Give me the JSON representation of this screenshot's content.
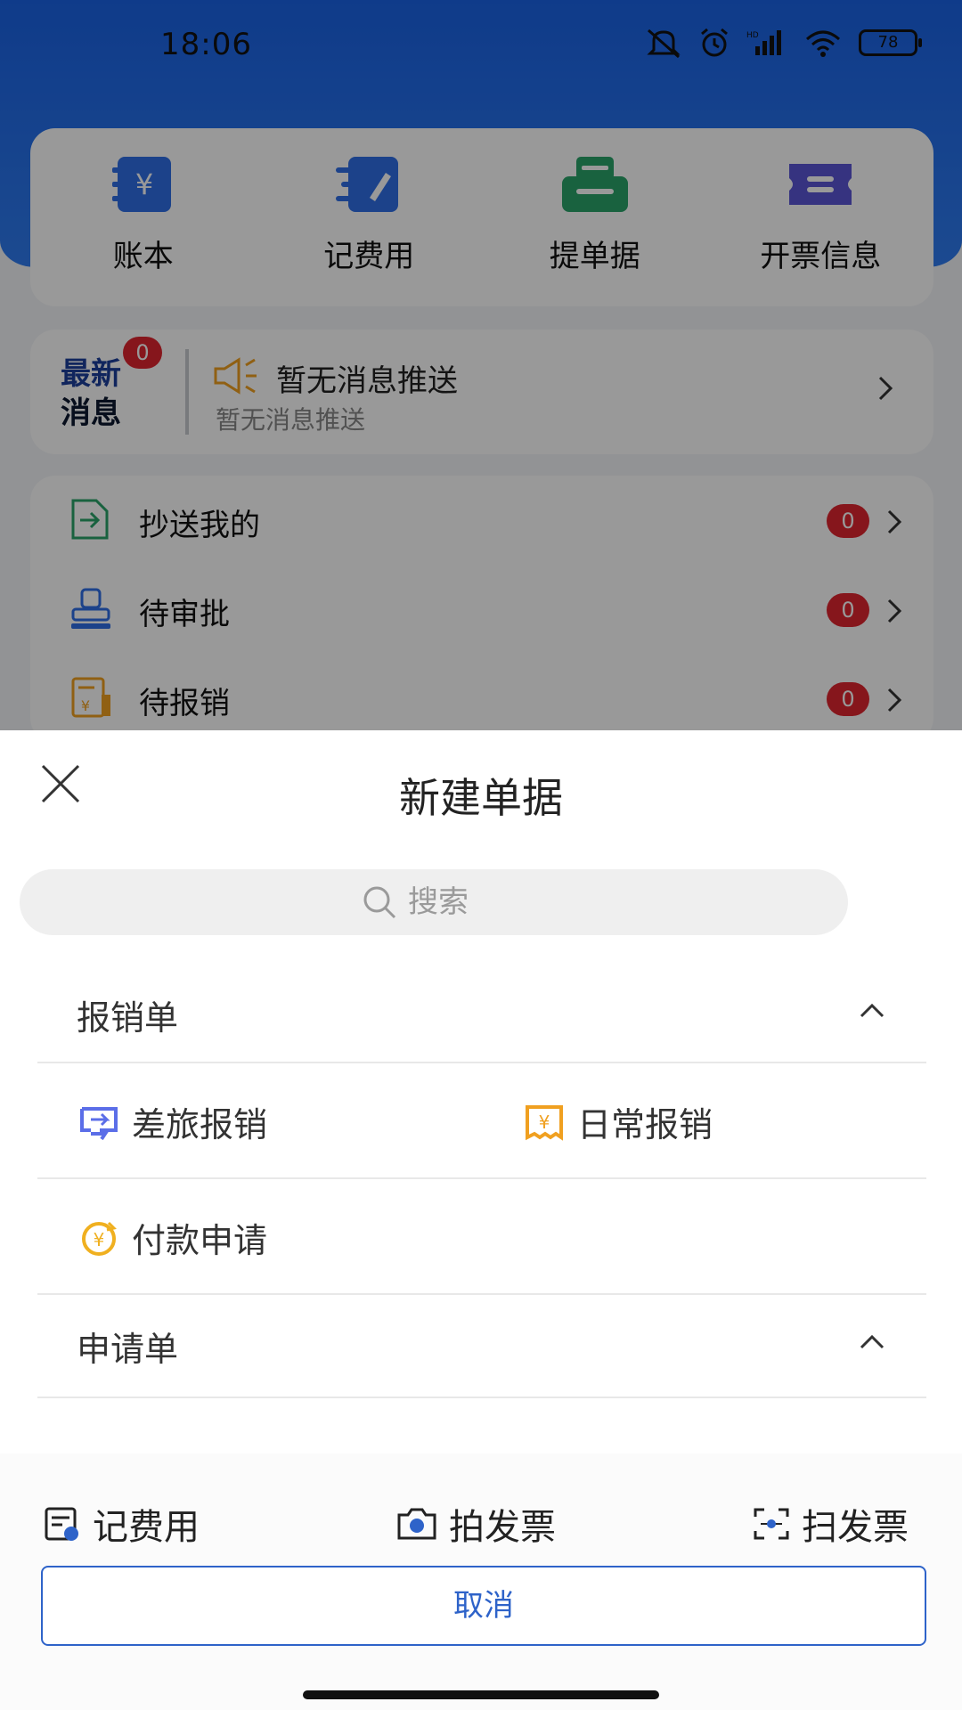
{
  "status_bar": {
    "time": "18:06",
    "battery": "78"
  },
  "quick_actions": [
    {
      "label": "账本",
      "icon": "ledger-icon",
      "color": "#2f6fe6"
    },
    {
      "label": "记费用",
      "icon": "record-expense-icon",
      "color": "#2f6fe6"
    },
    {
      "label": "提单据",
      "icon": "printer-icon",
      "color": "#2ba36a"
    },
    {
      "label": "开票信息",
      "icon": "ticket-icon",
      "color": "#5b56d6"
    }
  ],
  "news": {
    "logo_line1": "最新",
    "logo_line2": "消息",
    "badge": "0",
    "title": "暂无消息推送",
    "subtitle": "暂无消息推送"
  },
  "task_list": [
    {
      "label": "抄送我的",
      "count": "0",
      "icon": "cc-icon"
    },
    {
      "label": "待审批",
      "count": "0",
      "icon": "stamp-icon"
    },
    {
      "label": "待报销",
      "count": "0",
      "icon": "receipt-icon"
    }
  ],
  "sheet": {
    "title": "新建单据",
    "search_placeholder": "搜索",
    "sections": [
      {
        "label": "报销单",
        "options": [
          {
            "label": "差旅报销",
            "icon": "travel-expense-icon",
            "color": "#5b6ee8"
          },
          {
            "label": "日常报销",
            "icon": "daily-expense-icon",
            "color": "#f0a020"
          },
          {
            "label": "付款申请",
            "icon": "payment-request-icon",
            "color": "#f0b020"
          }
        ]
      },
      {
        "label": "申请单"
      }
    ],
    "tools": [
      {
        "label": "记费用",
        "icon": "record-expense-icon"
      },
      {
        "label": "拍发票",
        "icon": "camera-icon"
      },
      {
        "label": "扫发票",
        "icon": "scan-icon"
      }
    ],
    "cancel_label": "取消"
  },
  "colors": {
    "primary": "#2e63c9",
    "badge": "#e0262f",
    "header": "#1a63e6"
  }
}
